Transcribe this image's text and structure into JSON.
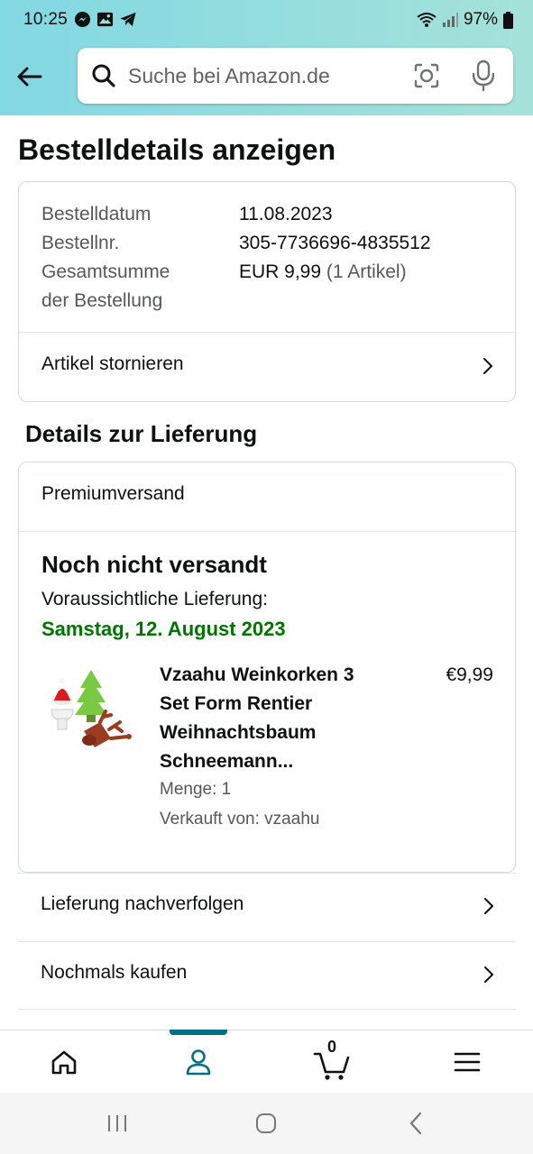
{
  "status_bar": {
    "time": "10:25",
    "battery": "97%",
    "icons": [
      "messenger-icon",
      "gallery-icon",
      "telegram-icon",
      "wifi-icon",
      "signal-icon",
      "battery-icon"
    ]
  },
  "search": {
    "placeholder": "Suche bei Amazon.de"
  },
  "page": {
    "title": "Bestelldetails anzeigen"
  },
  "order": {
    "date_label": "Bestelldatum",
    "date_value": "11.08.2023",
    "number_label": "Bestellnr.",
    "number_value": "305-7736696-4835512",
    "total_label_1": "Gesamtsumme",
    "total_label_2": "der Bestellung",
    "total_value": "EUR 9,99",
    "total_items": "(1 Artikel)",
    "cancel_label": "Artikel stornieren"
  },
  "delivery": {
    "heading": "Details zur Lieferung",
    "shipping_type": "Premiumversand",
    "status": "Noch nicht versandt",
    "eta_label": "Voraussichtliche Lieferung:",
    "eta_date": "Samstag, 12. August 2023",
    "item": {
      "title": "Vzaahu Weinkorken 3 Set Form Rentier Weihnachtsbaum Schneemann...",
      "price": "€9,99",
      "quantity": "Menge: 1",
      "seller": "Verkauft von: vzaahu"
    }
  },
  "actions": [
    {
      "label": "Lieferung nachverfolgen"
    },
    {
      "label": "Nochmals kaufen"
    }
  ],
  "bottom_nav": {
    "cart_count": "0",
    "active": "account",
    "accent_color": "#007185"
  },
  "colors": {
    "header_gradient_start": "#82d8e3",
    "header_gradient_end": "#a5e2d9",
    "delivery_date": "#007600"
  }
}
